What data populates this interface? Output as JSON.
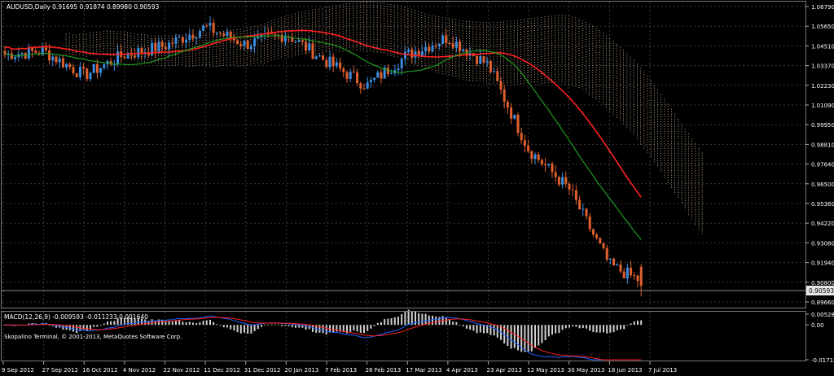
{
  "main_title": "AUDUSD,Daily  0.91695 0.91874 0.89980 0.90593",
  "macd_title": "MACD(12,26,9) -0.009593 -0.011233 0.001640",
  "copyright": "Skopalino Terminal, © 2001-2013, MetaQuotes Software Corp.",
  "current_price_label": "0.90593",
  "price_axis_labels": [
    "1.06790",
    "1.05650",
    "1.04510",
    "1.03370",
    "1.02230",
    "1.01090",
    "0.99950",
    "0.98810",
    "0.97640",
    "0.96500",
    "0.95360",
    "0.94220",
    "0.93080",
    "0.91940",
    "0.90800",
    "0.89660"
  ],
  "macd_axis_labels": [
    "0.005285",
    "0.00",
    "-0.017121"
  ],
  "date_labels": [
    "9 Sep 2012",
    "27 Sep 2012",
    "16 Oct 2012",
    "4 Nov 2012",
    "22 Nov 2012",
    "11 Dec 2012",
    "31 Dec 2012",
    "20 Jan 2013",
    "7 Feb 2013",
    "26 Feb 2013",
    "17 Mar 2013",
    "4 Apr 2013",
    "23 Apr 2013",
    "12 May 2013",
    "30 May 2013",
    "18 Jun 2013",
    "7 Jul 2013"
  ],
  "colors": {
    "background": "#000000",
    "grid": "#3a3a3a",
    "bull_candle": "#3c8de0",
    "bear_candle": "#e0602e",
    "ma_red": "#ff2020",
    "ma_green": "#1f9a1f",
    "cloud": "#e8c8a8",
    "macd_main": "#2060ff",
    "macd_signal": "#ff2020",
    "histogram": "#d0d0d0"
  },
  "chart_data": {
    "type": "candlestick",
    "title": "AUDUSD,Daily",
    "ohlc_last": {
      "open": 0.91695,
      "high": 0.91874,
      "low": 0.8998,
      "close": 0.90593
    },
    "ylim": [
      0.8966,
      1.0679
    ],
    "key_closes": [
      {
        "date": "9 Sep 2012",
        "close": 1.04
      },
      {
        "date": "27 Sep 2012",
        "close": 1.042
      },
      {
        "date": "16 Oct 2012",
        "close": 1.028
      },
      {
        "date": "4 Nov 2012",
        "close": 1.04
      },
      {
        "date": "22 Nov 2012",
        "close": 1.045
      },
      {
        "date": "11 Dec 2012",
        "close": 1.056
      },
      {
        "date": "31 Dec 2012",
        "close": 1.046
      },
      {
        "date": "20 Jan 2013",
        "close": 1.052
      },
      {
        "date": "7 Feb 2013",
        "close": 1.036
      },
      {
        "date": "26 Feb 2013",
        "close": 1.022
      },
      {
        "date": "17 Mar 2013",
        "close": 1.04
      },
      {
        "date": "4 Apr 2013",
        "close": 1.05
      },
      {
        "date": "23 Apr 2013",
        "close": 1.034
      },
      {
        "date": "12 May 2013",
        "close": 0.985
      },
      {
        "date": "30 May 2013",
        "close": 0.962
      },
      {
        "date": "18 Jun 2013",
        "close": 0.918
      },
      {
        "date": "7 Jul 2013",
        "close": 0.906
      }
    ],
    "macd": {
      "main": -0.009593,
      "signal": -0.011233,
      "histogram": 0.00164,
      "ylim": [
        -0.017121,
        0.005285
      ]
    }
  }
}
